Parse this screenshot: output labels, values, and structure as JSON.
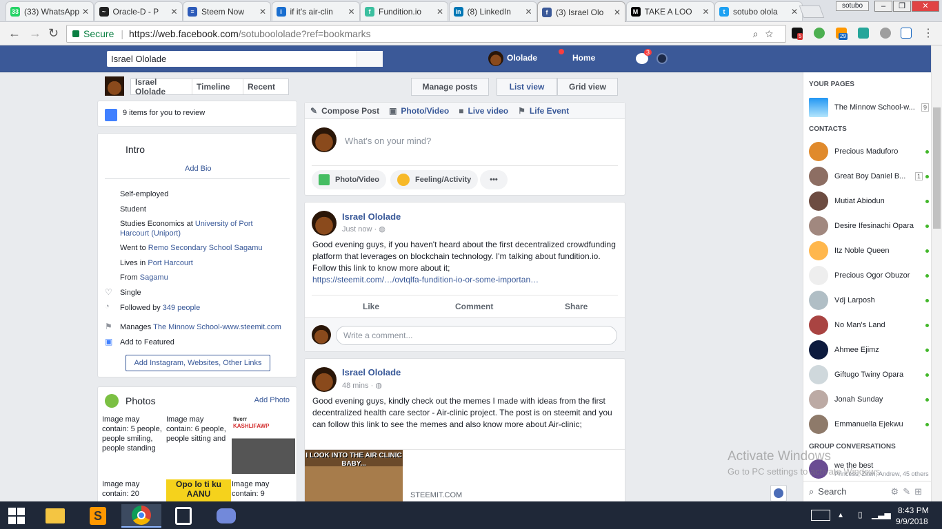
{
  "browser": {
    "tabs": [
      {
        "label": "(33) WhatsApp",
        "color": "#25d366",
        "fav": "33"
      },
      {
        "label": "Oracle-D - P",
        "color": "#222222",
        "fav": "~"
      },
      {
        "label": "Steem Now",
        "color": "#2d5bb9",
        "fav": "≡"
      },
      {
        "label": "if it's air-clin",
        "color": "#1a6fd0",
        "fav": "i"
      },
      {
        "label": "Fundition.io",
        "color": "#3bbf9f",
        "fav": "f"
      },
      {
        "label": "(8) LinkedIn",
        "color": "#0077b5",
        "fav": "in"
      },
      {
        "label": "(3) Israel Olo",
        "color": "#3b5998",
        "fav": "f"
      },
      {
        "label": "TAKE A LOO",
        "color": "#000000",
        "fav": "M"
      },
      {
        "label": "sotubo olola",
        "color": "#1da1f2",
        "fav": "t"
      }
    ],
    "profile": "sotubo",
    "secure_label": "Secure",
    "url_host": "https://web.facebook.com",
    "url_rest": "/sotuboololade?ref=bookmarks",
    "ext_badges": {
      "a": "5",
      "b": "29"
    }
  },
  "fb_header": {
    "search_value": "Israel Ololade",
    "user_name": "Ololade",
    "home_label": "Home",
    "messenger_count": "3"
  },
  "profile_nav": {
    "name": "Israel Ololade",
    "timeline": "Timeline",
    "recent": "Recent",
    "manage_posts": "Manage posts",
    "list_view": "List view",
    "grid_view": "Grid view"
  },
  "review": {
    "text": "9 items for you to review"
  },
  "intro": {
    "title": "Intro",
    "add_bio": "Add Bio",
    "rows": {
      "job": "Self-employed",
      "student": "Student",
      "studies_prefix": "Studies Economics at ",
      "studies_link": "University of Port Harcourt (Uniport)",
      "went_prefix": "Went to ",
      "went_link": "Remo Secondary School Sagamu",
      "lives_prefix": "Lives in ",
      "lives_link": "Port Harcourt",
      "from_prefix": "From ",
      "from_link": "Sagamu",
      "single": "Single",
      "followed_prefix": "Followed by ",
      "followed_link": "349 people",
      "manages_prefix": "Manages ",
      "manages_link": "The Minnow School-www.steemit.com",
      "add_featured": "Add to Featured"
    },
    "add_links_button": "Add Instagram, Websites, Other Links"
  },
  "photos": {
    "title": "Photos",
    "add_photo": "Add Photo",
    "alts": [
      "Image may contain: 5 people, people smiling, people standing",
      "Image may contain: 6 people, people sitting and",
      "Image may contain: 20",
      "Image may contain: 9"
    ],
    "thumb_texts": {
      "fiverr": "fiverr",
      "kash": "KASHLIFAWP",
      "opo": "Opo lo ti ku AANU"
    }
  },
  "composer": {
    "tabs": [
      "Compose Post",
      "Photo/Video",
      "Live video",
      "Life Event"
    ],
    "placeholder": "What's on your mind?",
    "actions": [
      "Photo/Video",
      "Feeling/Activity",
      "•••"
    ]
  },
  "posts": [
    {
      "author": "Israel Ololade",
      "time": "Just now",
      "text": "Good evening guys, if you haven't heard about the first decentralized crowdfunding platform that leverages on blockchain technology. I'm talking about fundition.io. Follow this link to know more about it;",
      "link": "https://steemit.com/…/ovtqlfa-fundition-io-or-some-importan…",
      "like": "Like",
      "comment": "Comment",
      "share": "Share",
      "comment_placeholder": "Write a comment..."
    },
    {
      "author": "Israel Ololade",
      "time": "48 mins",
      "text": "Good evening guys, kindly check out the memes I made with ideas from the first decentralized health care sector - Air-clinic project. The post is on steemit and you can follow this link to see the memes and also know more about Air-clinic;",
      "meme_caption": "I LOOK INTO THE AIR CLINIC BABY...",
      "link_domain": "STEEMIT.COM"
    }
  ],
  "sidebar": {
    "your_pages": "YOUR PAGES",
    "page_name": "The Minnow School-w...",
    "page_count": "9",
    "contacts_label": "CONTACTS",
    "contacts": [
      {
        "name": "Precious Maduforo",
        "online": true
      },
      {
        "name": "Great Boy Daniel B...",
        "online": true,
        "count": "1"
      },
      {
        "name": "Mutiat Abiodun",
        "online": true
      },
      {
        "name": "Desire Ifesinachi Opara",
        "online": true
      },
      {
        "name": "Itz Noble Queen",
        "online": true
      },
      {
        "name": "Precious Ogor Obuzor",
        "online": true
      },
      {
        "name": "Vdj Larposh",
        "online": true
      },
      {
        "name": "No Man's Land",
        "online": true
      },
      {
        "name": "Ahmee Ejimz",
        "online": true
      },
      {
        "name": "Giftugo Twiny Opara",
        "online": true
      },
      {
        "name": "Jonah Sunday",
        "online": true
      },
      {
        "name": "Emmanuella Ejekwu",
        "online": true
      }
    ],
    "group_label": "GROUP CONVERSATIONS",
    "group_name": "we the best",
    "group_members": "Princess, Ziten, Andrew, 45 others",
    "search": "Search"
  },
  "watermark": {
    "line1": "Activate Windows",
    "line2": "Go to PC settings to activate Windows."
  },
  "taskbar": {
    "time": "8:43 PM",
    "date": "9/9/2018"
  }
}
